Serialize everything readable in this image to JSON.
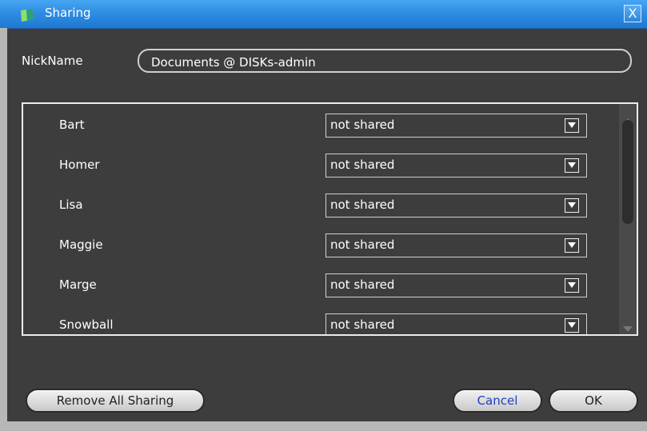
{
  "window": {
    "title": "Sharing",
    "close_glyph": "X",
    "icon": "app-icon"
  },
  "nickname": {
    "label": "NickName",
    "value": "Documents @ DISKs-admin"
  },
  "users": [
    {
      "name": "Bart",
      "share": "not shared"
    },
    {
      "name": "Homer",
      "share": "not shared"
    },
    {
      "name": "Lisa",
      "share": "not shared"
    },
    {
      "name": "Maggie",
      "share": "not shared"
    },
    {
      "name": "Marge",
      "share": "not shared"
    },
    {
      "name": "Snowball",
      "share": "not shared"
    }
  ],
  "buttons": {
    "remove_all": "Remove All Sharing",
    "cancel": "Cancel",
    "ok": "OK"
  },
  "colors": {
    "titlebar": "#2f8de3",
    "background": "#3d3d3d",
    "cancel_text": "#1e3fbf"
  }
}
